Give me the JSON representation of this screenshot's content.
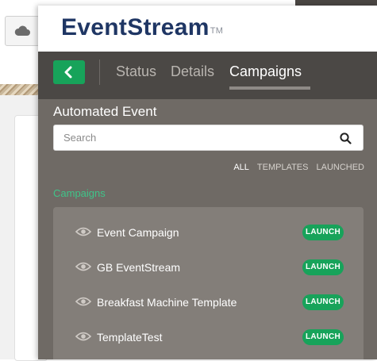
{
  "background": {
    "cloud_icon": "cloud-icon"
  },
  "brand": {
    "name": "EventStream",
    "trademark": "TM"
  },
  "tabs": [
    {
      "label": "Status",
      "active": false
    },
    {
      "label": "Details",
      "active": false
    },
    {
      "label": "Campaigns",
      "active": true
    }
  ],
  "back_icon": "chevron-left-icon",
  "main": {
    "title": "Automated Event",
    "search": {
      "placeholder": "Search",
      "value": "",
      "icon": "search-icon"
    },
    "filters": [
      {
        "label": "ALL",
        "active": true
      },
      {
        "label": "TEMPLATES",
        "active": false
      },
      {
        "label": "LAUNCHED",
        "active": false
      }
    ],
    "campaigns_label": "Campaigns",
    "campaigns": [
      {
        "name": "Event Campaign",
        "action": "LAUNCH",
        "icon": "eye-icon"
      },
      {
        "name": "GB EventStream",
        "action": "LAUNCH",
        "icon": "eye-icon"
      },
      {
        "name": "Breakfast Machine Template",
        "action": "LAUNCH",
        "icon": "eye-icon"
      },
      {
        "name": "TemplateTest",
        "action": "LAUNCH",
        "icon": "eye-icon"
      }
    ]
  },
  "colors": {
    "brand": "#1f3664",
    "accent_green": "#17a35a",
    "link_green": "#3fc489",
    "tab_bar": "#4b4845",
    "content_bg": "#6f6a65",
    "list_bg": "#837e79"
  }
}
